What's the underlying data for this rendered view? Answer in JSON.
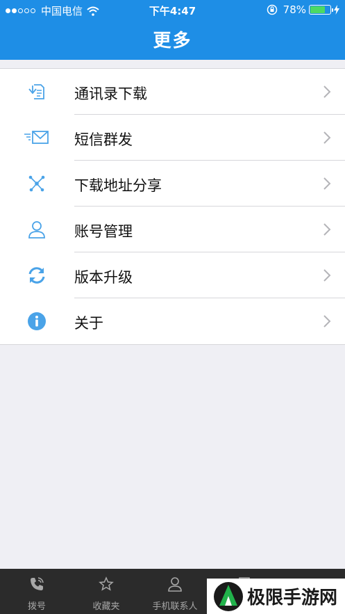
{
  "status_bar": {
    "carrier": "中国电信",
    "time": "下午4:47",
    "battery": "78%",
    "battery_level": 0.78
  },
  "header": {
    "title": "更多"
  },
  "menu": [
    {
      "label": "通讯录下载",
      "icon": "contacts-download-icon"
    },
    {
      "label": "短信群发",
      "icon": "mail-send-icon"
    },
    {
      "label": "下载地址分享",
      "icon": "share-icon"
    },
    {
      "label": "账号管理",
      "icon": "account-icon"
    },
    {
      "label": "版本升级",
      "icon": "refresh-icon"
    },
    {
      "label": "关于",
      "icon": "info-icon"
    }
  ],
  "tabs": [
    {
      "label": "拨号",
      "icon": "phone-icon"
    },
    {
      "label": "收藏夹",
      "icon": "star-icon"
    },
    {
      "label": "手机联系人",
      "icon": "person-icon"
    }
  ],
  "watermark": {
    "text": "极限手游网"
  },
  "colors": {
    "accent": "#1e8ee6",
    "icon_blue": "#4aa3e8",
    "tab_bg": "#2b2b2b"
  }
}
